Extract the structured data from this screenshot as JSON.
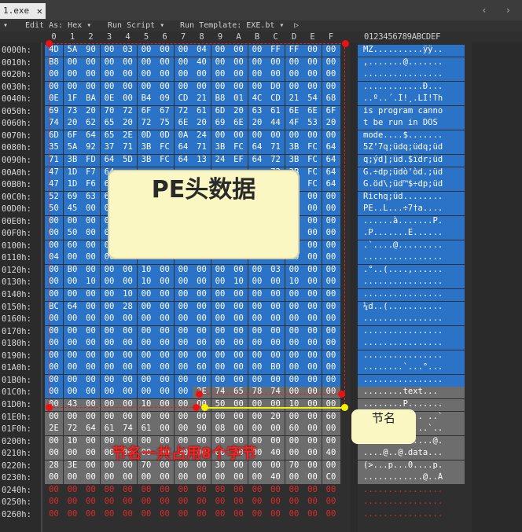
{
  "tab": {
    "label": "1.exe",
    "close": "✕"
  },
  "toolbar": {
    "collapse": "▾",
    "edit_as": "Edit As: Hex ▾",
    "run_script": "Run Script ▾",
    "run_template": "Run Template: EXE.bt ▾",
    "play": "▷"
  },
  "columns": [
    "0",
    "1",
    "2",
    "3",
    "4",
    "5",
    "6",
    "7",
    "8",
    "9",
    "A",
    "B",
    "C",
    "D",
    "E",
    "F"
  ],
  "ascii_header": "0123456789ABCDEF",
  "rows": [
    {
      "addr": "0000h:",
      "hex": [
        "4D",
        "5A",
        "90",
        "00",
        "03",
        "00",
        "00",
        "00",
        "04",
        "00",
        "00",
        "00",
        "FF",
        "FF",
        "00",
        "00"
      ],
      "ascii": "MZ..........ÿÿ.."
    },
    {
      "addr": "0010h:",
      "hex": [
        "B8",
        "00",
        "00",
        "00",
        "00",
        "00",
        "00",
        "00",
        "40",
        "00",
        "00",
        "00",
        "00",
        "00",
        "00",
        "00"
      ],
      "ascii": ",.......@......."
    },
    {
      "addr": "0020h:",
      "hex": [
        "00",
        "00",
        "00",
        "00",
        "00",
        "00",
        "00",
        "00",
        "00",
        "00",
        "00",
        "00",
        "00",
        "00",
        "00",
        "00"
      ],
      "ascii": "................"
    },
    {
      "addr": "0030h:",
      "hex": [
        "00",
        "00",
        "00",
        "00",
        "00",
        "00",
        "00",
        "00",
        "00",
        "00",
        "00",
        "00",
        "D0",
        "00",
        "00",
        "00"
      ],
      "ascii": "............Ð..."
    },
    {
      "addr": "0040h:",
      "hex": [
        "0E",
        "1F",
        "BA",
        "0E",
        "00",
        "B4",
        "09",
        "CD",
        "21",
        "B8",
        "01",
        "4C",
        "CD",
        "21",
        "54",
        "68"
      ],
      "ascii": "..º..´.Í!¸.LÍ!Th"
    },
    {
      "addr": "0050h:",
      "hex": [
        "69",
        "73",
        "20",
        "70",
        "72",
        "6F",
        "67",
        "72",
        "61",
        "6D",
        "20",
        "63",
        "61",
        "6E",
        "6E",
        "6F"
      ],
      "ascii": "is program canno"
    },
    {
      "addr": "0060h:",
      "hex": [
        "74",
        "20",
        "62",
        "65",
        "20",
        "72",
        "75",
        "6E",
        "20",
        "69",
        "6E",
        "20",
        "44",
        "4F",
        "53",
        "20"
      ],
      "ascii": "t be run in DOS "
    },
    {
      "addr": "0070h:",
      "hex": [
        "6D",
        "6F",
        "64",
        "65",
        "2E",
        "0D",
        "0D",
        "0A",
        "24",
        "00",
        "00",
        "00",
        "00",
        "00",
        "00",
        "00"
      ],
      "ascii": "mode....$......."
    },
    {
      "addr": "0080h:",
      "hex": [
        "35",
        "5A",
        "92",
        "37",
        "71",
        "3B",
        "FC",
        "64",
        "71",
        "3B",
        "FC",
        "64",
        "71",
        "3B",
        "FC",
        "64"
      ],
      "ascii": "5Z’7q;üdq;üdq;üd"
    },
    {
      "addr": "0090h:",
      "hex": [
        "71",
        "3B",
        "FD",
        "64",
        "5D",
        "3B",
        "FC",
        "64",
        "13",
        "24",
        "EF",
        "64",
        "72",
        "3B",
        "FC",
        "64"
      ],
      "ascii": "q;ýd];üd.$ïdr;üd"
    },
    {
      "addr": "00A0h:",
      "hex": [
        "47",
        "1D",
        "F7",
        "64",
        "",
        "",
        "",
        "",
        "",
        "",
        "",
        "",
        "72",
        "3B",
        "FC",
        "64"
      ],
      "ascii": "G.÷dp;üdò'òd.;üd"
    },
    {
      "addr": "00B0h:",
      "hex": [
        "47",
        "1D",
        "F6",
        "64",
        "",
        "",
        "",
        "",
        "",
        "",
        "",
        "",
        "70",
        "3B",
        "FC",
        "64"
      ],
      "ascii": "G.öd\\;üd™$÷dp;üd"
    },
    {
      "addr": "00C0h:",
      "hex": [
        "52",
        "69",
        "63",
        "68",
        "",
        "",
        "",
        "",
        "",
        "",
        "",
        "",
        "00",
        "00",
        "00",
        "00"
      ],
      "ascii": "Richq;üd........"
    },
    {
      "addr": "00D0h:",
      "hex": [
        "50",
        "45",
        "00",
        "00",
        "",
        "",
        "",
        "",
        "",
        "",
        "",
        "",
        "00",
        "10",
        "00",
        "00"
      ],
      "ascii": "PE..L...÷7†a...."
    },
    {
      "addr": "00E0h:",
      "hex": [
        "00",
        "00",
        "00",
        "00",
        "",
        "",
        "",
        "",
        "",
        "",
        "",
        "",
        "00",
        "10",
        "00",
        "00"
      ],
      "ascii": "......à.......P."
    },
    {
      "addr": "00F0h:",
      "hex": [
        "00",
        "50",
        "00",
        "00",
        "",
        "",
        "",
        "",
        "",
        "",
        "",
        "",
        "00",
        "00",
        "00",
        "00"
      ],
      "ascii": ".P.......E......"
    },
    {
      "addr": "0100h:",
      "hex": [
        "00",
        "60",
        "00",
        "00",
        "",
        "",
        "",
        "",
        "",
        "",
        "",
        "",
        "00",
        "00",
        "00",
        "00"
      ],
      "ascii": ".`....@........."
    },
    {
      "addr": "0110h:",
      "hex": [
        "04",
        "00",
        "00",
        "00",
        "00",
        "00",
        "00",
        "00",
        "00",
        "00",
        "00",
        "00",
        "00",
        "00",
        "00",
        "00"
      ],
      "ascii": "................"
    },
    {
      "addr": "0120h:",
      "hex": [
        "00",
        "B0",
        "00",
        "00",
        "00",
        "10",
        "00",
        "00",
        "00",
        "00",
        "00",
        "00",
        "03",
        "00",
        "00",
        "00"
      ],
      "ascii": ".°..(....,......"
    },
    {
      "addr": "0130h:",
      "hex": [
        "00",
        "00",
        "10",
        "00",
        "00",
        "10",
        "00",
        "00",
        "00",
        "00",
        "10",
        "00",
        "00",
        "10",
        "00",
        "00"
      ],
      "ascii": "................"
    },
    {
      "addr": "0140h:",
      "hex": [
        "00",
        "00",
        "00",
        "00",
        "10",
        "00",
        "00",
        "00",
        "00",
        "00",
        "00",
        "00",
        "00",
        "00",
        "00",
        "00"
      ],
      "ascii": "................"
    },
    {
      "addr": "0150h:",
      "hex": [
        "BC",
        "64",
        "00",
        "00",
        "28",
        "00",
        "00",
        "00",
        "00",
        "00",
        "00",
        "00",
        "00",
        "00",
        "00",
        "00"
      ],
      "ascii": "¼d..(..........."
    },
    {
      "addr": "0160h:",
      "hex": [
        "00",
        "00",
        "00",
        "00",
        "00",
        "00",
        "00",
        "00",
        "00",
        "00",
        "00",
        "00",
        "00",
        "00",
        "00",
        "00"
      ],
      "ascii": "................"
    },
    {
      "addr": "0170h:",
      "hex": [
        "00",
        "00",
        "00",
        "00",
        "00",
        "00",
        "00",
        "00",
        "00",
        "00",
        "00",
        "00",
        "00",
        "00",
        "00",
        "00"
      ],
      "ascii": "................"
    },
    {
      "addr": "0180h:",
      "hex": [
        "00",
        "00",
        "00",
        "00",
        "00",
        "00",
        "00",
        "00",
        "00",
        "00",
        "00",
        "00",
        "00",
        "00",
        "00",
        "00"
      ],
      "ascii": "................"
    },
    {
      "addr": "0190h:",
      "hex": [
        "00",
        "00",
        "00",
        "00",
        "00",
        "00",
        "00",
        "00",
        "00",
        "00",
        "00",
        "00",
        "00",
        "00",
        "00",
        "00"
      ],
      "ascii": "................"
    },
    {
      "addr": "01A0h:",
      "hex": [
        "00",
        "00",
        "00",
        "00",
        "00",
        "00",
        "00",
        "00",
        "60",
        "00",
        "00",
        "00",
        "B0",
        "00",
        "00",
        "00"
      ],
      "ascii": "........`...°..."
    },
    {
      "addr": "01B0h:",
      "hex": [
        "00",
        "00",
        "00",
        "00",
        "00",
        "00",
        "00",
        "00",
        "00",
        "00",
        "00",
        "00",
        "00",
        "00",
        "00",
        "00"
      ],
      "ascii": "................"
    },
    {
      "addr": "01C0h:",
      "hex": [
        "00",
        "00",
        "00",
        "00",
        "00",
        "00",
        "00",
        "00",
        "2E",
        "74",
        "65",
        "78",
        "74",
        "00",
        "00",
        "00"
      ],
      "ascii": "........text..."
    },
    {
      "addr": "01D0h:",
      "hex": [
        "00",
        "43",
        "00",
        "00",
        "00",
        "10",
        "00",
        "00",
        "00",
        "50",
        "00",
        "00",
        "00",
        "10",
        "00",
        "00"
      ],
      "ascii": "........P......."
    },
    {
      "addr": "01E0h:",
      "hex": [
        "00",
        "00",
        "00",
        "00",
        "00",
        "00",
        "00",
        "00",
        "00",
        "00",
        "00",
        "00",
        "20",
        "00",
        "00",
        "60"
      ],
      "ascii": "............ ..`"
    },
    {
      "addr": "01F0h:",
      "hex": [
        "2E",
        "72",
        "64",
        "61",
        "74",
        "61",
        "00",
        "00",
        "90",
        "08",
        "00",
        "00",
        "00",
        "60",
        "00",
        "00"
      ],
      "ascii": ".rdata.......`.."
    },
    {
      "addr": "0200h:",
      "hex": [
        "00",
        "10",
        "00",
        "00",
        "00",
        "00",
        "00",
        "00",
        "00",
        "00",
        "00",
        "00",
        "00",
        "00",
        "00",
        "00"
      ],
      "ascii": "....`.........@."
    },
    {
      "addr": "0210h:",
      "hex": [
        "00",
        "00",
        "00",
        "00",
        "00",
        "00",
        "00",
        "00",
        "00",
        "00",
        "00",
        "00",
        "40",
        "00",
        "00",
        "40"
      ],
      "ascii": "....@..@.data..."
    },
    {
      "addr": "0220h:",
      "hex": [
        "28",
        "3E",
        "00",
        "00",
        "00",
        "70",
        "00",
        "00",
        "00",
        "30",
        "00",
        "00",
        "00",
        "70",
        "00",
        "00"
      ],
      "ascii": "(>...p...0....p."
    },
    {
      "addr": "0230h:",
      "hex": [
        "00",
        "00",
        "00",
        "00",
        "00",
        "00",
        "00",
        "00",
        "00",
        "00",
        "00",
        "00",
        "40",
        "00",
        "00",
        "C0"
      ],
      "ascii": "............@..À"
    },
    {
      "addr": "0240h:",
      "hex": [
        "00",
        "00",
        "00",
        "00",
        "00",
        "00",
        "00",
        "00",
        "00",
        "00",
        "00",
        "00",
        "00",
        "00",
        "00",
        "00"
      ],
      "ascii": "................"
    },
    {
      "addr": "0250h:",
      "hex": [
        "00",
        "00",
        "00",
        "00",
        "00",
        "00",
        "00",
        "00",
        "00",
        "00",
        "00",
        "00",
        "00",
        "00",
        "00",
        "00"
      ],
      "ascii": "................"
    },
    {
      "addr": "0260h:",
      "hex": [
        "00",
        "00",
        "00",
        "00",
        "00",
        "00",
        "00",
        "00",
        "00",
        "00",
        "00",
        "00",
        "00",
        "00",
        "00",
        "00"
      ],
      "ascii": "................"
    }
  ],
  "annotations": {
    "pe_header_label": "PE头数据",
    "section_name_label": "节名",
    "section_name_note": "节名一共占用8个字节"
  },
  "colors": {
    "selection": "#2b73c6",
    "section_gray": "#6d6d6d",
    "zero_red": "#dd2a2a",
    "callout": "#fbf7c2",
    "marker_red": "#e11111",
    "marker_yellow": "#f5f200"
  }
}
